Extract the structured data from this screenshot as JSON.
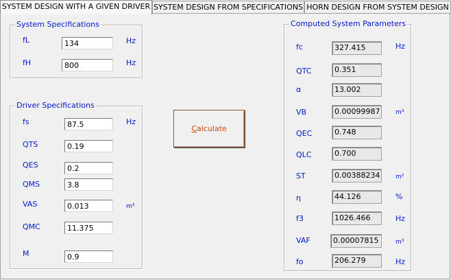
{
  "tabs": [
    {
      "label": "SYSTEM DESIGN WITH A GIVEN DRIVER",
      "active": true
    },
    {
      "label": "SYSTEM DESIGN FROM SPECIFICATIONS",
      "active": false
    },
    {
      "label": "HORN DESIGN FROM SYSTEM DESIGN",
      "active": false
    }
  ],
  "system_specs": {
    "title": "System Specifications",
    "fL": {
      "label": "fL",
      "value": "134",
      "unit": "Hz"
    },
    "fH": {
      "label": "fH",
      "value": "800",
      "unit": "Hz"
    }
  },
  "driver_specs": {
    "title": "Driver Specifications",
    "fs": {
      "label": "fs",
      "value": "87.5",
      "unit": "Hz"
    },
    "QTS": {
      "label": "QTS",
      "value": "0.19"
    },
    "QES": {
      "label": "QES",
      "value": "0.2"
    },
    "QMS": {
      "label": "QMS",
      "value": "3.8"
    },
    "VAS": {
      "label": "VAS",
      "value": "0.013",
      "unit": "m³"
    },
    "QMC": {
      "label": "QMC",
      "value": "11.375"
    },
    "M": {
      "label": "M",
      "value": "0.9"
    }
  },
  "calculate_button": {
    "underlined": "C",
    "rest": "alculate"
  },
  "computed": {
    "title": "Computed System Parameters",
    "fc": {
      "label": "fc",
      "value": "327.415",
      "unit": "Hz"
    },
    "QTC": {
      "label": "QTC",
      "value": "0.351"
    },
    "alpha": {
      "label": "α",
      "value": "13.002"
    },
    "VB": {
      "label": "VB",
      "value": "0.00099987",
      "unit": "m³"
    },
    "QEC": {
      "label": "QEC",
      "value": "0.748"
    },
    "QLC": {
      "label": "QLC",
      "value": "0.700"
    },
    "ST": {
      "label": "ST",
      "value": "0.00388234",
      "unit": "m²"
    },
    "eta": {
      "label": "η",
      "value": "44.126",
      "unit": "%"
    },
    "f3": {
      "label": "f3",
      "value": "1026.466",
      "unit": "Hz"
    },
    "VAF": {
      "label": "VAF",
      "value": "0.00007815",
      "unit": "m³"
    },
    "fo": {
      "label": "fo",
      "value": "206.279",
      "unit": "Hz"
    }
  }
}
